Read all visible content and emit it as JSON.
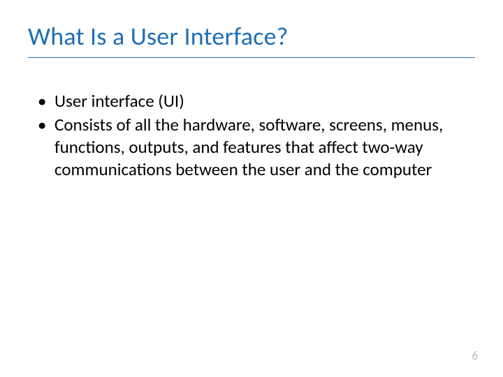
{
  "title": "What Is a User Interface?",
  "bullets": [
    "User interface (UI)",
    "Consists of all the hardware, software, screens, menus, functions, outputs, and features that affect two-way communications between the user and the computer"
  ],
  "page_number": "6"
}
